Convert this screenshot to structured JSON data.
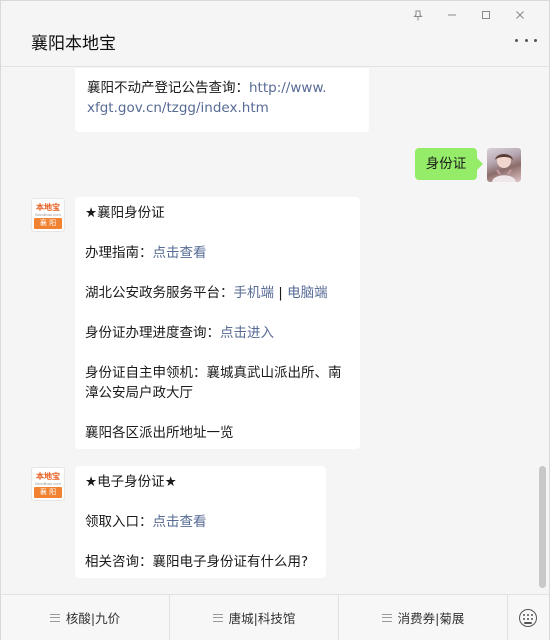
{
  "window": {
    "title": "襄阳本地宝",
    "controls": [
      "pin-icon",
      "minimize-icon",
      "maximize-icon",
      "close-icon"
    ]
  },
  "messages": {
    "prev_bubble": {
      "label": "襄阳不动产登记公告查询：",
      "link_line1": "http://www.",
      "link_line2": "xfgt.gov.cn/tzgg/index.htm"
    },
    "user_message": "身份证",
    "id_card_bubble": {
      "title": "★襄阳身份证",
      "guide_label": "办理指南：",
      "guide_link": "点击查看",
      "platform_label": "湖北公安政务服务平台：",
      "platform_mobile": "手机端",
      "platform_sep": " | ",
      "platform_pc": "电脑端",
      "progress_label": "身份证办理进度查询：",
      "progress_link": "点击进入",
      "selfservice_line1": "身份证自主申领机：襄城真武山派出所、南",
      "selfservice_line2": "漳公安局户政大厅",
      "stations": "襄阳各区派出所地址一览"
    },
    "e_id_bubble": {
      "title": "★电子身份证★",
      "entry_label": "领取入口：",
      "entry_link": "点击查看",
      "consult": "相关咨询：襄阳电子身份证有什么用?"
    }
  },
  "bot_avatar": {
    "brand": "本地宝",
    "sub": "Bendibao.com",
    "city": "襄 阳"
  },
  "menu": {
    "items": [
      "核酸|九价",
      "唐城|科技馆",
      "消费券|菊展"
    ],
    "keyboard_icon": "keyboard-icon"
  },
  "colors": {
    "user_bubble": "#95ec69",
    "link": "#576b95",
    "brand_orange": "#f08232"
  }
}
